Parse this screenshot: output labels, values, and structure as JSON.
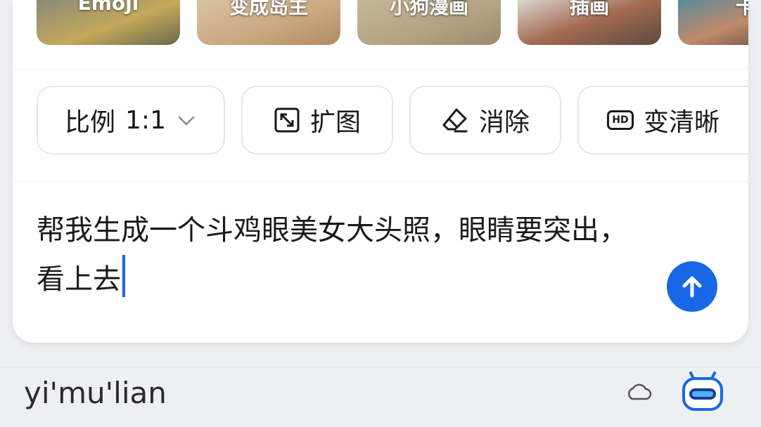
{
  "styles": [
    {
      "label": "Emoji"
    },
    {
      "label": "变成岛主"
    },
    {
      "label": "小狗漫画"
    },
    {
      "label": "插画"
    },
    {
      "label": "卡"
    }
  ],
  "tools": {
    "ratio_label": "比例",
    "ratio_value": "1:1",
    "expand_label": "扩图",
    "erase_label": "消除",
    "enhance_label": "变清晰",
    "hd_badge": "HD"
  },
  "prompt": {
    "text": "帮我生成一个斗鸡眼美女大头照，眼睛要突出，看上去"
  },
  "ime": {
    "pinyin": "yi'mu'lian"
  },
  "colors": {
    "accent": "#1967e6",
    "background": "#eeeff3"
  }
}
